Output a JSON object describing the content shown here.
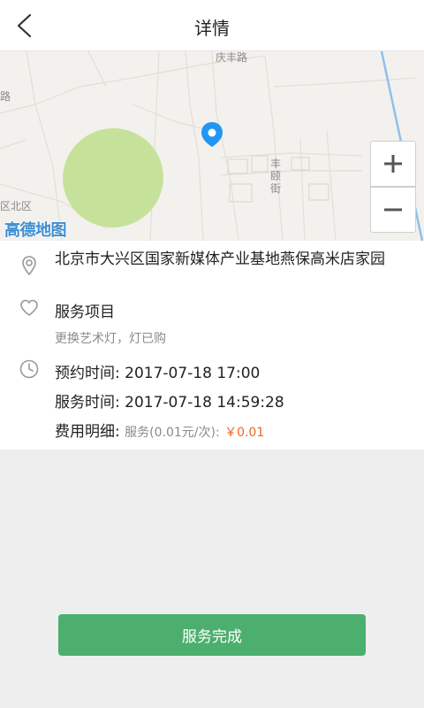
{
  "header": {
    "title": "详情",
    "back_icon": "chevron-left-icon"
  },
  "map": {
    "logo": "高德地图",
    "labels": {
      "road_top": "庆丰路",
      "street_right": "丰颐街",
      "district_left": "区北区",
      "fragment_left": "路"
    },
    "zoom_in": "+",
    "zoom_out": "−",
    "pin_color": "#2196f3"
  },
  "details": {
    "address": "北京市大兴区国家新媒体产业基地燕保高米店家园",
    "service_title": "服务项目",
    "service_desc": "更换艺术灯，灯已购",
    "appointment_label": "预约时间:",
    "appointment_time": "2017-07-18 17:00",
    "service_time_label": "服务时间:",
    "service_time": "2017-07-18 14:59:28",
    "fee_label": "费用明细:",
    "fee_detail": "服务(0.01元/次):",
    "fee_amount": "￥0.01"
  },
  "actions": {
    "complete_button": "服务完成"
  },
  "colors": {
    "accent": "#4caf6e",
    "price": "#f26522",
    "map_park": "#c6e29a"
  }
}
